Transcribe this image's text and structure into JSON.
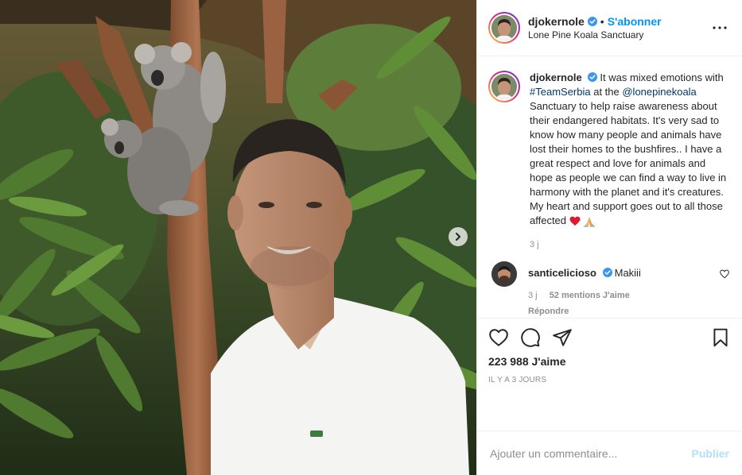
{
  "post": {
    "username": "djokernole",
    "follow_label": "S'abonner",
    "separator": "•",
    "location": "Lone Pine Koala Sanctuary",
    "more_label": "•••"
  },
  "caption": {
    "username": "djokernole",
    "text_before_tag1": "It was mixed emotions with ",
    "tag1": "#TeamSerbia",
    "text_between": " at the ",
    "tag2": "@lonepinekoala",
    "text_after": " Sanctuary to help raise awareness about their endangered habitats. It's very sad to know how many people and animals have lost their homes to the bushfires.. I have a great respect and love for animals and hope as people we can find a way to live in harmony with the planet and it's creatures. My heart and support goes out to all those affected ",
    "emojis": [
      "heart-emoji",
      "praying-hands-emoji"
    ],
    "age": "3 j"
  },
  "comment": {
    "username": "santicelicioso",
    "text": "Makiii",
    "age": "3 j",
    "likes": "52 mentions J'aime",
    "reply": "Répondre"
  },
  "actions": {
    "icons": [
      "heart-icon",
      "comment-icon",
      "share-icon",
      "bookmark-icon"
    ],
    "likes_count": "223 988 J'aime",
    "posted_ago": "IL Y A 3 JOURS"
  },
  "add_comment": {
    "placeholder": "Ajouter un commentaire...",
    "publish_label": "Publier"
  },
  "colors": {
    "accent": "#0095f6",
    "publish_disabled": "#b2dffc",
    "verified": "#3897f0",
    "hashtag": "#00376b"
  }
}
